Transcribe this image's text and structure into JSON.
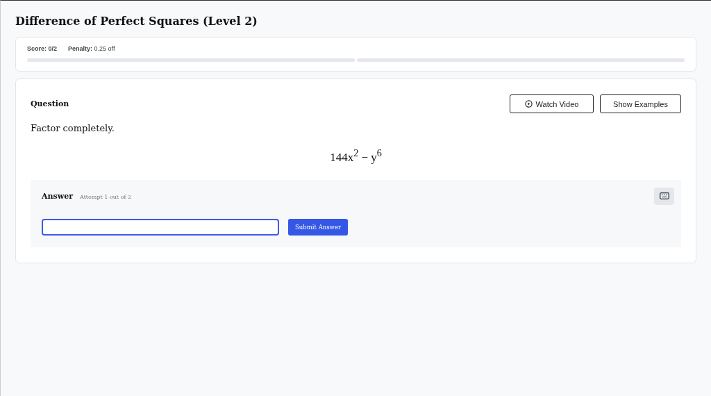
{
  "title": "Difference of Perfect Squares (Level 2)",
  "score": {
    "label": "Score:",
    "value": "0/2"
  },
  "penalty": {
    "label": "Penalty:",
    "value": "0.25 off"
  },
  "progress": [
    {
      "level": 0
    },
    {
      "level": 0
    }
  ],
  "question": {
    "heading": "Question",
    "buttons": [
      {
        "kind": "video",
        "label": "Watch Video"
      },
      {
        "kind": "plain",
        "label": "Show Examples"
      }
    ],
    "prompt": "Factor completely.",
    "expression": "144x$^{2}$ − y$^{6}$"
  },
  "answer": {
    "heading": "Answer",
    "attempt": "Attempt 1 out of 2",
    "submit": "Submit Answer"
  }
}
